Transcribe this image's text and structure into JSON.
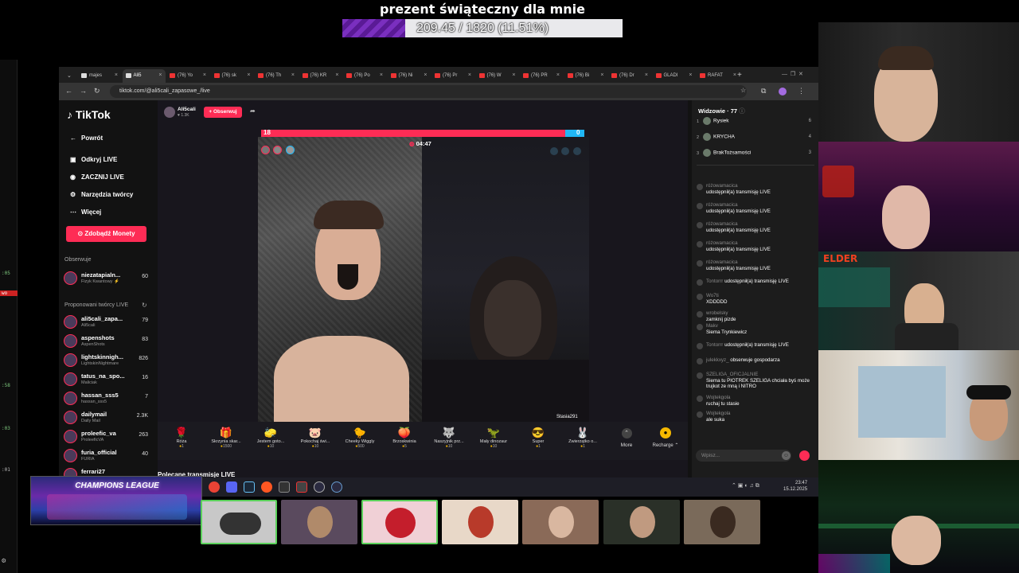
{
  "goal": {
    "title": "prezent świąteczny dla mnie",
    "progress_text": "209.45 / 1820 (11.51%)",
    "progress_fraction": 0.1151,
    "fill_color": "#7a2fbf"
  },
  "left_strip": {
    "items": [
      ":05",
      "wo",
      ":58",
      ":03",
      ":01"
    ]
  },
  "browser": {
    "tabs": [
      {
        "label": "majes"
      },
      {
        "label": "Ali5"
      },
      {
        "label": "(76) Yo"
      },
      {
        "label": "(76) sk"
      },
      {
        "label": "(76) Th"
      },
      {
        "label": "(76) KR"
      },
      {
        "label": "(76) Po"
      },
      {
        "label": "(76) Ni"
      },
      {
        "label": "(76) Pr"
      },
      {
        "label": "(76) W"
      },
      {
        "label": "(76) PR"
      },
      {
        "label": "(76) Bi"
      },
      {
        "label": "(76) Dr"
      },
      {
        "label": "GLADI"
      },
      {
        "label": "RAFAT"
      }
    ],
    "new_tab": "+",
    "url": "tiktok.com/@ali5cali_zapasowe_/live"
  },
  "sidebar": {
    "logo": "TikTok",
    "nav": [
      {
        "icon": "←",
        "label": "Powrót"
      },
      {
        "icon": "▣",
        "label": "Odkryj LIVE"
      },
      {
        "icon": "◉",
        "label": "ZACZNIJ LIVE"
      },
      {
        "icon": "⚙",
        "label": "Narzędzia twórcy"
      },
      {
        "icon": "⋯",
        "label": "Więcej"
      }
    ],
    "coins_button": "Zdobądź Monety",
    "followed_label": "Obserwuje",
    "followed": [
      {
        "name": "niezatapialn...",
        "sub": "Fizyk Kwantowy ⚡",
        "count": "60"
      }
    ],
    "suggested_label": "Proponowani twórcy LIVE",
    "suggested": [
      {
        "name": "ali5cali_zapa...",
        "sub": "Ali5cali",
        "count": "79"
      },
      {
        "name": "aspenshots",
        "sub": "AspenShots",
        "count": "83"
      },
      {
        "name": "lightskinnigh...",
        "sub": "LightskinNightmare",
        "count": "826"
      },
      {
        "name": "tatus_na_spo...",
        "sub": "Maliciak",
        "count": "16"
      },
      {
        "name": "hassan_sss5",
        "sub": "hassan_sss5",
        "count": "7"
      },
      {
        "name": "dailymail",
        "sub": "Daily Mail",
        "count": "2.3K"
      },
      {
        "name": "proleefic_va",
        "sub": "ProleeficVA",
        "count": "263"
      },
      {
        "name": "furia_official",
        "sub": "FURIA",
        "count": "40"
      },
      {
        "name": "ferrari27",
        "sub": "",
        "count": ""
      }
    ]
  },
  "live": {
    "host_name": "Ali5cali",
    "host_likes": "1.3K",
    "follow_button": "+ Obserwuj",
    "score_left": "18",
    "score_right": "0",
    "score_left_share": 0.94,
    "timer": "04:47",
    "guest_name": "Stasia291",
    "related_label": "Polecane transmisje LIVE"
  },
  "gifts": [
    {
      "icon": "🌹",
      "name": "Róża",
      "price": "1"
    },
    {
      "icon": "🎁",
      "name": "Skrzynia skar...",
      "price": "1500"
    },
    {
      "icon": "🧽",
      "name": "Jestem goto...",
      "price": "10"
    },
    {
      "icon": "🐷",
      "name": "Pokochaj świ...",
      "price": "10"
    },
    {
      "icon": "🐤",
      "name": "Cheeky Wiggly",
      "price": "500"
    },
    {
      "icon": "🍑",
      "name": "Brzoskwinia",
      "price": "5"
    },
    {
      "icon": "🐺",
      "name": "Naszyjnik prz...",
      "price": "10"
    },
    {
      "icon": "🦖",
      "name": "Mały dinozaur",
      "price": "10"
    },
    {
      "icon": "😎",
      "name": "Super",
      "price": "1"
    },
    {
      "icon": "🐰",
      "name": "Zwierzątko o...",
      "price": "1"
    }
  ],
  "gift_more": "More",
  "recharge": "Recharge",
  "chat": {
    "viewers_title": "Widzowie · 77",
    "viewers": [
      {
        "rank": "1",
        "name": "Rysiek",
        "count": "6"
      },
      {
        "rank": "2",
        "name": "KRYCHA",
        "count": "4"
      },
      {
        "rank": "3",
        "name": "BrakTożsamości",
        "count": "3"
      }
    ],
    "messages": [
      {
        "user": "różowamacica",
        "text": "udostępnił(a) transmisję LIVE"
      },
      {
        "user": "różowamacica",
        "text": "udostępnił(a) transmisję LIVE"
      },
      {
        "user": "różowamacica",
        "text": "udostępnił(a) transmisję LIVE"
      },
      {
        "user": "różowamacica",
        "text": "udostępnił(a) transmisję LIVE"
      },
      {
        "user": "różowamacica",
        "text": "udostępnił(a) transmisję LIVE"
      },
      {
        "user": "Tontorrr",
        "text": "udostępnił(a) transmisję LIVE"
      },
      {
        "user": "Wo7ti",
        "text": "XDDDDD"
      },
      {
        "user": "wrobelsky",
        "text": "zamknij pizde"
      },
      {
        "user": "Makv",
        "text": "Siema Trynkiewicz"
      },
      {
        "user": "Tontorrr",
        "text": "udostępnił(a) transmisję LIVE"
      },
      {
        "user": "julekkxyz_",
        "text": "obserwuje gospodarza"
      },
      {
        "user": "SZELIGA_OFICJALNIE",
        "text": "Siema tu PIOTREK SZELIGA chciała byś może trujkot ze mną i NITRO"
      },
      {
        "user": "Wojtekgola",
        "text": "ruchaj tu stasie"
      },
      {
        "user": "Wojtekgola",
        "text": "ale suka"
      }
    ],
    "input_placeholder": "Wpisz..."
  },
  "taskbar": {
    "time": "23:47",
    "date": "15.12.2025"
  },
  "overlay": {
    "champions_league": "CHAMPIONS LEAGUE",
    "cam_label": "ELDER"
  }
}
